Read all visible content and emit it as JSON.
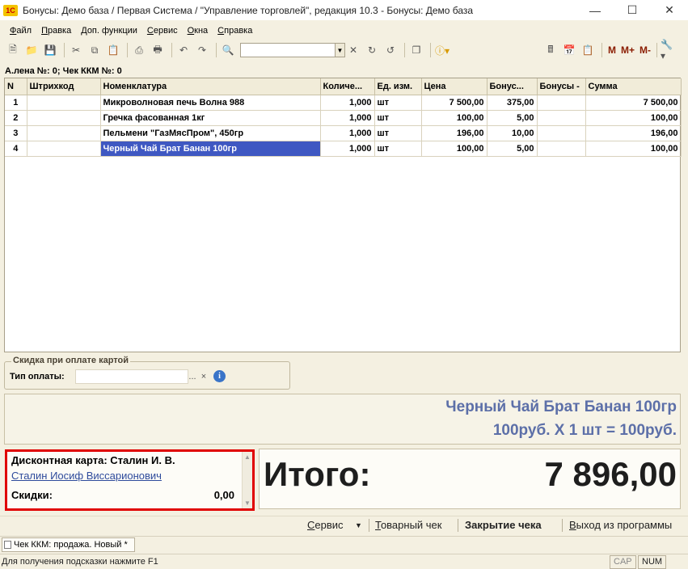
{
  "window": {
    "title": "Бонусы: Демо база / Первая Система / \"Управление торговлей\", редакция 10.3 - Бонусы: Демо база",
    "minimize_icon": "minimize-icon",
    "maximize_icon": "maximize-icon",
    "close_icon": "close-icon"
  },
  "menu": {
    "items": [
      {
        "hotkey": "Ф",
        "rest": "айл"
      },
      {
        "hotkey": "П",
        "rest": "равка"
      },
      {
        "hotkey": "Д",
        "rest": "оп. функции"
      },
      {
        "hotkey": "С",
        "rest": "ервис"
      },
      {
        "hotkey": "О",
        "rest": "кна"
      },
      {
        "hotkey": "С",
        "rest": "правка"
      }
    ]
  },
  "toolbar": {
    "search_value": "",
    "memory_buttons": [
      "M",
      "M+",
      "M-"
    ]
  },
  "doc_header": "А.лена №: 0; Чек ККМ №: 0",
  "table": {
    "columns": [
      "N",
      "Штрихкод",
      "Номенклатура",
      "Количе...",
      "Ед. изм.",
      "Цена",
      "Бонус...",
      "Бонусы -",
      "Сумма"
    ],
    "rows": [
      {
        "n": "1",
        "barcode": "",
        "item": "Микроволновая печь Волна 988",
        "qty": "1,000",
        "unit": "шт",
        "price": "7 500,00",
        "bonus": "375,00",
        "bonus_minus": "",
        "sum": "7 500,00"
      },
      {
        "n": "2",
        "barcode": "",
        "item": "Гречка фасованная 1кг",
        "qty": "1,000",
        "unit": "шт",
        "price": "100,00",
        "bonus": "5,00",
        "bonus_minus": "",
        "sum": "100,00"
      },
      {
        "n": "3",
        "barcode": "",
        "item": "Пельмени \"ГазМясПром\", 450гр",
        "qty": "1,000",
        "unit": "шт",
        "price": "196,00",
        "bonus": "10,00",
        "bonus_minus": "",
        "sum": "196,00"
      },
      {
        "n": "4",
        "barcode": "",
        "item": "Черный Чай Брат Банан 100гр",
        "qty": "1,000",
        "unit": "шт",
        "price": "100,00",
        "bonus": "5,00",
        "bonus_minus": "",
        "sum": "100,00"
      }
    ],
    "selected_row": 3
  },
  "card_payment": {
    "title": "Скидка при оплате картой",
    "pay_type_label": "Тип оплаты:",
    "pay_type_value": "",
    "select_btn": "...",
    "clear_btn": "×",
    "info_icon": "i"
  },
  "product_display": {
    "name": "Черный Чай Брат Банан 100гр",
    "calc": "100руб. Х 1 шт = 100руб."
  },
  "discount_card": {
    "label": "Дисконтная карта: Сталин И. В.",
    "owner_link": "Сталин Иосиф Виссарионович",
    "discounts_label": "Скидки:",
    "discounts_value": "0,00"
  },
  "total": {
    "label": "Итого:",
    "value": "7 896,00"
  },
  "bottom_actions": {
    "service": {
      "hotkey": "С",
      "rest": "ервис"
    },
    "receipt": {
      "hotkey": "Т",
      "rest": "оварный чек"
    },
    "close_check": "Закрытие чека",
    "exit": {
      "hotkey": "В",
      "rest": "ыход из программы"
    }
  },
  "taskbar": {
    "tab_label": "Чек ККМ: продажа. Новый *"
  },
  "status": {
    "hint": "Для получения подсказки нажмите F1",
    "cap": "CAP",
    "num": "NUM"
  },
  "colors": {
    "selection": "#3f58c2",
    "product_text": "#5c6fa8",
    "link": "#2e4b9c",
    "highlight_border": "#e00000",
    "background": "#f4f0e1"
  }
}
